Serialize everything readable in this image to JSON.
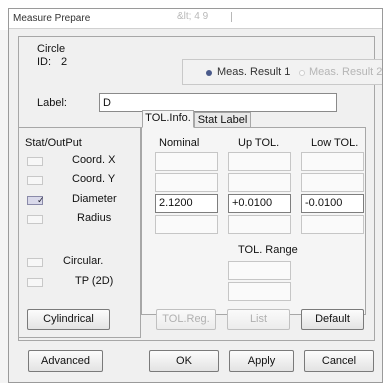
{
  "window": {
    "title": "Measure Prepare",
    "background_text": "&lt; 4 9"
  },
  "element": {
    "type_label": "Circle",
    "id_label": "ID:",
    "id_value": "2"
  },
  "result_selector": {
    "options": [
      {
        "label": "Meas. Result 1",
        "selected": true
      },
      {
        "label": "Meas. Result 2",
        "selected": false
      }
    ]
  },
  "label_field": {
    "caption": "Label:",
    "value": "D"
  },
  "stat_output": {
    "heading": "Stat/OutPut",
    "items": [
      {
        "label": "Coord. X",
        "checked": false
      },
      {
        "label": "Coord. Y",
        "checked": false
      },
      {
        "label": "Diameter",
        "checked": true
      },
      {
        "label": "Radius",
        "checked": false
      },
      {
        "label": "Circular.",
        "checked": false
      },
      {
        "label": "TP (2D)",
        "checked": false
      }
    ],
    "cylindrical_button": "Cylindrical"
  },
  "tabs": [
    {
      "label": "TOL.Info.",
      "active": true
    },
    {
      "label": "Stat Label",
      "active": false
    }
  ],
  "tolerance": {
    "columns": [
      "Nominal",
      "Up TOL.",
      "Low TOL."
    ],
    "rows": [
      [
        "",
        "",
        ""
      ],
      [
        "",
        "",
        ""
      ],
      [
        "2.1200",
        "+0.0100",
        "-0.0100"
      ],
      [
        "",
        "",
        ""
      ]
    ],
    "range_label": "TOL. Range",
    "range_fields": [
      "",
      ""
    ],
    "buttons": {
      "tol_reg": "TOL.Reg.",
      "list": "List",
      "default": "Default"
    }
  },
  "footer": {
    "advanced": "Advanced",
    "ok": "OK",
    "apply": "Apply",
    "cancel": "Cancel"
  },
  "colors": {
    "accent_radio": "#4a5a8a",
    "dialog_bg": "#f0f0f0",
    "border": "#a7a7a7"
  }
}
